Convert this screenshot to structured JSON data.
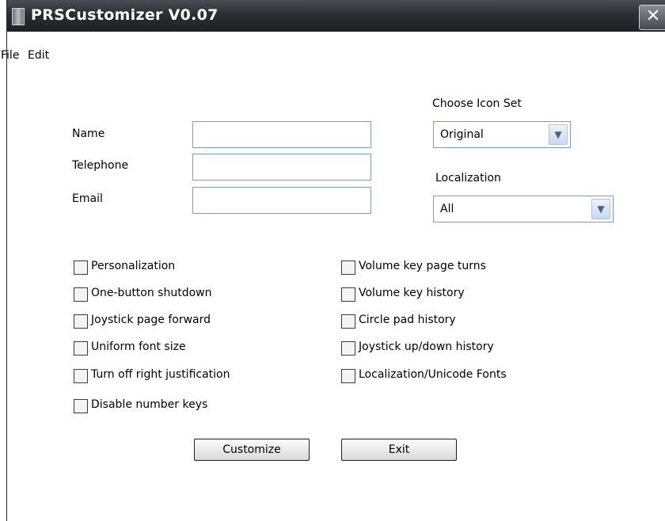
{
  "window": {
    "title": "PRSCustomizer V0.07",
    "close_glyph": "✕"
  },
  "menu": {
    "items": [
      "File",
      "Edit"
    ]
  },
  "form": {
    "name_label": "Name",
    "name_value": "",
    "telephone_label": "Telephone",
    "telephone_value": "",
    "email_label": "Email",
    "email_value": ""
  },
  "icon_set": {
    "label": "Choose Icon Set",
    "selected": "Original"
  },
  "localization": {
    "label": "Localization",
    "selected": "All"
  },
  "options_left": [
    {
      "label": "Personalization",
      "checked": false
    },
    {
      "label": "One-button shutdown",
      "checked": false
    },
    {
      "label": "Joystick page forward",
      "checked": false
    },
    {
      "label": "Uniform font size",
      "checked": false
    },
    {
      "label": "Turn off right justification",
      "checked": false
    },
    {
      "label": "Disable number keys",
      "checked": false
    }
  ],
  "options_right": [
    {
      "label": "Volume key page turns",
      "checked": false
    },
    {
      "label": "Volume key history",
      "checked": false
    },
    {
      "label": "Circle pad history",
      "checked": false
    },
    {
      "label": "Joystick up/down history",
      "checked": false
    },
    {
      "label": "Localization/Unicode Fonts",
      "checked": false
    }
  ],
  "buttons": {
    "customize": "Customize",
    "exit": "Exit"
  },
  "colors": {
    "titlebar": "#2b2e33",
    "field_border": "#7f9db9",
    "combo_arrow": "#c9d7f1"
  }
}
